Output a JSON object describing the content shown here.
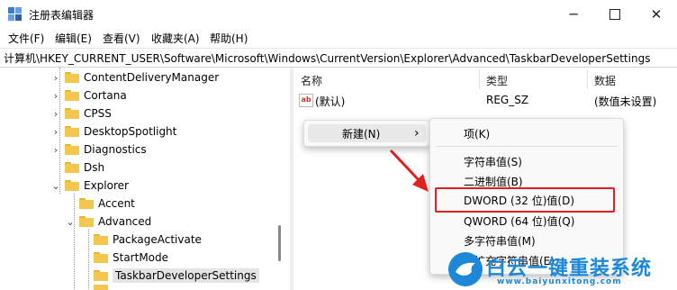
{
  "window": {
    "title": "注册表编辑器"
  },
  "menu": [
    "文件(F)",
    "编辑(E)",
    "查看(V)",
    "收藏夹(A)",
    "帮助(H)"
  ],
  "address": "计算机\\HKEY_CURRENT_USER\\Software\\Microsoft\\Windows\\CurrentVersion\\Explorer\\Advanced\\TaskbarDeveloperSettings",
  "tree": [
    {
      "label": "ContentDeliveryManager",
      "chevron": "›"
    },
    {
      "label": "Cortana",
      "chevron": "›"
    },
    {
      "label": "CPSS",
      "chevron": "›"
    },
    {
      "label": "DesktopSpotlight",
      "chevron": "›"
    },
    {
      "label": "Diagnostics",
      "chevron": "›"
    },
    {
      "label": "Dsh",
      "chevron": ""
    },
    {
      "label": "Explorer",
      "chevron": "⌄"
    },
    {
      "label": "Accent",
      "chevron": ""
    },
    {
      "label": "Advanced",
      "chevron": "⌄"
    },
    {
      "label": "PackageActivate",
      "chevron": ""
    },
    {
      "label": "StartMode",
      "chevron": ""
    },
    {
      "label": "TaskbarDeveloperSettings",
      "chevron": "",
      "selected": true
    }
  ],
  "list": {
    "headers": {
      "name": "名称",
      "type": "类型",
      "data": "数据"
    },
    "rows": [
      {
        "icon": "ab",
        "name": "(默认)",
        "type": "REG_SZ",
        "data": "(数值未设置)"
      }
    ]
  },
  "context_menu": {
    "new_label": "新建(N)",
    "new_arrow": "›"
  },
  "submenu": {
    "items": [
      "项(K)",
      "字符串值(S)",
      "二进制值(B)",
      "DWORD (32 位)值(D)",
      "QWORD (64 位)值(Q)",
      "多字符串值(M)",
      "可扩充字符串值(E)"
    ]
  },
  "watermark": {
    "brand": "白云一键重装系统",
    "url": "www.baiyunxitong.com"
  },
  "colors": {
    "highlight_box": "#e02020",
    "folder": "#f3c64d",
    "watermark": "#1e88d8"
  }
}
